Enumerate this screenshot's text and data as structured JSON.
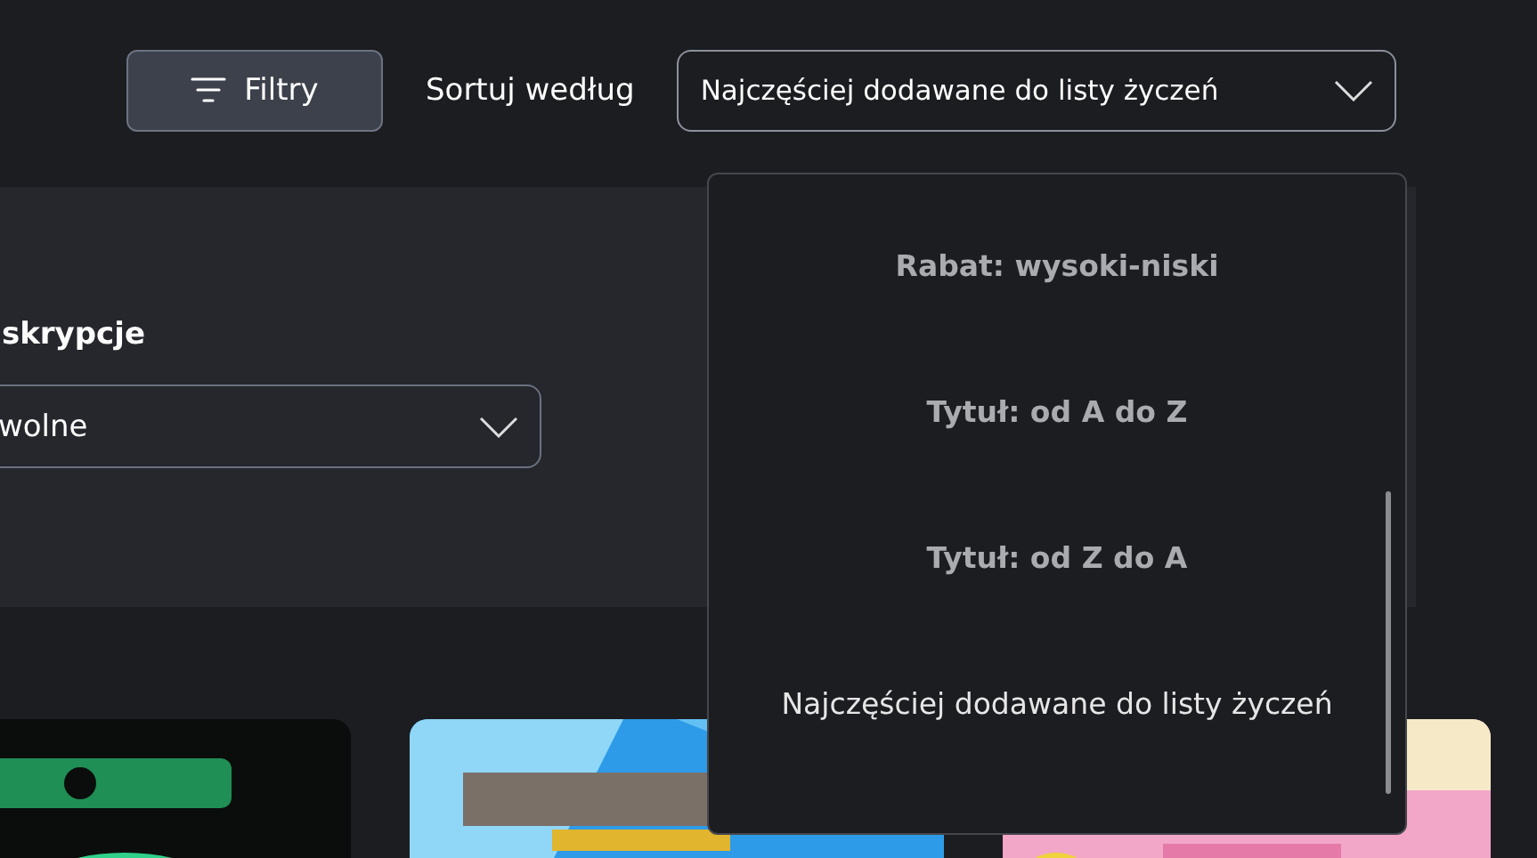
{
  "toolbar": {
    "filter_button": {
      "label": "Filtry"
    },
    "sort_label": "Sortuj według",
    "sort_dropdown": {
      "value": "Najczęściej dodawane do listy życzeń",
      "expanded": true
    }
  },
  "filter_panel": {
    "label": "skrypcje",
    "select": {
      "value": "wolne"
    }
  },
  "sort_menu": [
    {
      "label": "Rabat: wysoki-niski",
      "selected": false
    },
    {
      "label": "Tytuł: od A do Z",
      "selected": false
    },
    {
      "label": "Tytuł: od Z do A",
      "selected": false
    },
    {
      "label": "Najczęściej dodawane do listy życzeń",
      "selected": true
    }
  ]
}
